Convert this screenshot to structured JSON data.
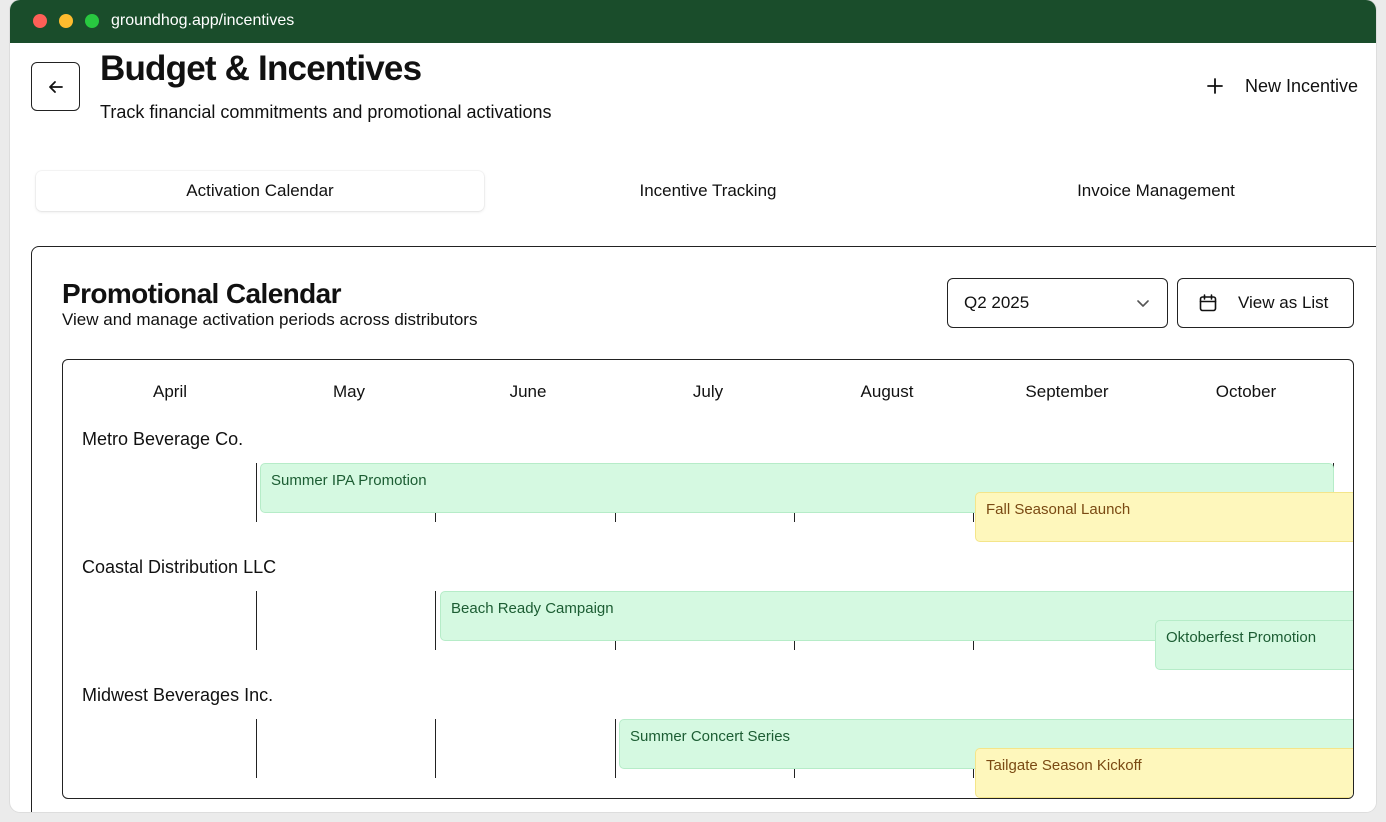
{
  "browser": {
    "url": "groundhog.app/incentives"
  },
  "header": {
    "title": "Budget & Incentives",
    "subtitle": "Track financial commitments and promotional activations",
    "new_incentive_label": "New Incentive"
  },
  "tabs": [
    {
      "label": "Activation Calendar",
      "active": true
    },
    {
      "label": "Incentive Tracking",
      "active": false
    },
    {
      "label": "Invoice Management",
      "active": false
    }
  ],
  "calendar": {
    "title": "Promotional Calendar",
    "subtitle": "View and manage activation periods across distributors",
    "quarter_selected": "Q2 2025",
    "view_list_label": "View as List",
    "months": [
      "April",
      "May",
      "June",
      "July",
      "August",
      "September",
      "October"
    ],
    "distributors": [
      {
        "name": "Metro Beverage Co.",
        "activations": [
          {
            "name": "Summer IPA Promotion",
            "color": "green"
          },
          {
            "name": "Fall Seasonal Launch",
            "color": "yellow"
          }
        ]
      },
      {
        "name": "Coastal Distribution LLC",
        "activations": [
          {
            "name": "Beach Ready Campaign",
            "color": "green"
          },
          {
            "name": "Oktoberfest Promotion",
            "color": "green"
          }
        ]
      },
      {
        "name": "Midwest Beverages Inc.",
        "activations": [
          {
            "name": "Summer Concert Series",
            "color": "green"
          },
          {
            "name": "Tailgate Season Kickoff",
            "color": "yellow"
          }
        ]
      }
    ]
  },
  "colors": {
    "titlebar": "#1a4d2b",
    "activation_green_bg": "#d5f9e1",
    "activation_green_text": "#1c5d33",
    "activation_yellow_bg": "#fef7bc",
    "activation_yellow_text": "#7a4a13"
  },
  "icons": {
    "back": "arrow-left-icon",
    "new": "plus-icon",
    "select": "chevron-down-icon",
    "view_list": "calendar-icon"
  }
}
